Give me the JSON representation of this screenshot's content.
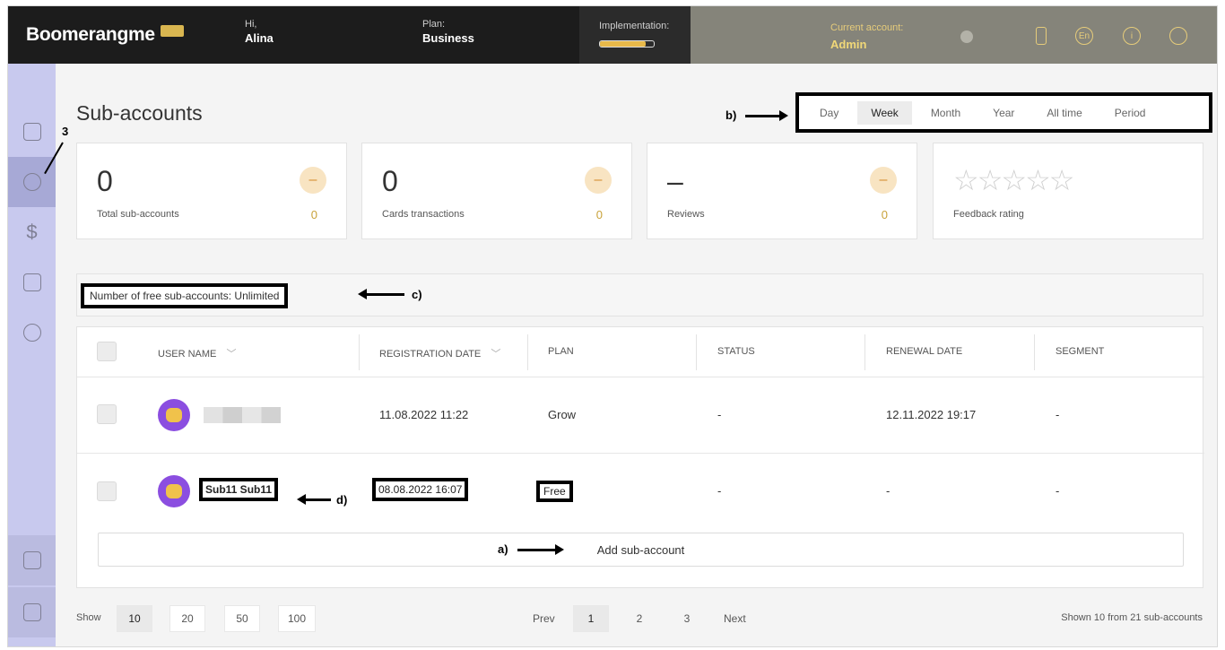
{
  "topbar": {
    "logo": "Boomerangme",
    "greeting_label": "Hi,",
    "user_name": "Alina",
    "plan_label": "Plan:",
    "plan_value": "Business",
    "implementation_label": "Implementation:",
    "implementation_progress": 0.85,
    "account_label": "Current account:",
    "account_value": "Admin",
    "language": "En",
    "info_icon": "i",
    "accent_color": "#e6cc7a"
  },
  "sidebar": {
    "items": [
      {
        "name": "home-icon"
      },
      {
        "name": "users-icon",
        "active": true
      },
      {
        "name": "dollar-icon"
      },
      {
        "name": "cards-icon"
      },
      {
        "name": "settings-icon"
      },
      {
        "name": "crown-icon"
      },
      {
        "name": "store-icon"
      }
    ]
  },
  "main": {
    "title": "Sub-accounts",
    "periods": [
      "Day",
      "Week",
      "Month",
      "Year",
      "All time",
      "Period"
    ],
    "active_period": "Week",
    "stats": [
      {
        "value": "0",
        "caption": "Total sub-accounts",
        "count": "0"
      },
      {
        "value": "0",
        "caption": "Cards transactions",
        "count": "0"
      },
      {
        "value": "–",
        "caption": "Reviews",
        "count": "0"
      },
      {
        "caption": "Feedback rating",
        "rating": 0,
        "stars": "☆☆☆☆☆"
      }
    ],
    "free_text": "Number of free sub-accounts: Unlimited",
    "table": {
      "headers": [
        "USER NAME",
        "REGISTRATION DATE",
        "PLAN",
        "STATUS",
        "RENEWAL DATE",
        "SEGMENT"
      ],
      "rows": [
        {
          "name": "",
          "registration": "11.08.2022 11:22",
          "plan": "Grow",
          "status": "-",
          "renewal": "12.11.2022 19:17",
          "segment": "-"
        },
        {
          "name": "Sub11 Sub11",
          "registration": "08.08.2022 16:07",
          "plan": "Free",
          "status": "-",
          "renewal": "-",
          "segment": "-"
        }
      ],
      "add_label": "Add sub-account"
    },
    "pagination": {
      "show_label": "Show",
      "sizes": [
        "10",
        "20",
        "50",
        "100"
      ],
      "active_size": "10",
      "prev": "Prev",
      "pages": [
        "1",
        "2",
        "3"
      ],
      "active_page": "1",
      "next": "Next",
      "shown_text": "Shown 10 from 21 sub-accounts"
    }
  },
  "annotations": {
    "a": "a)",
    "b": "b)",
    "c": "c)",
    "d": "d)",
    "three": "3"
  }
}
